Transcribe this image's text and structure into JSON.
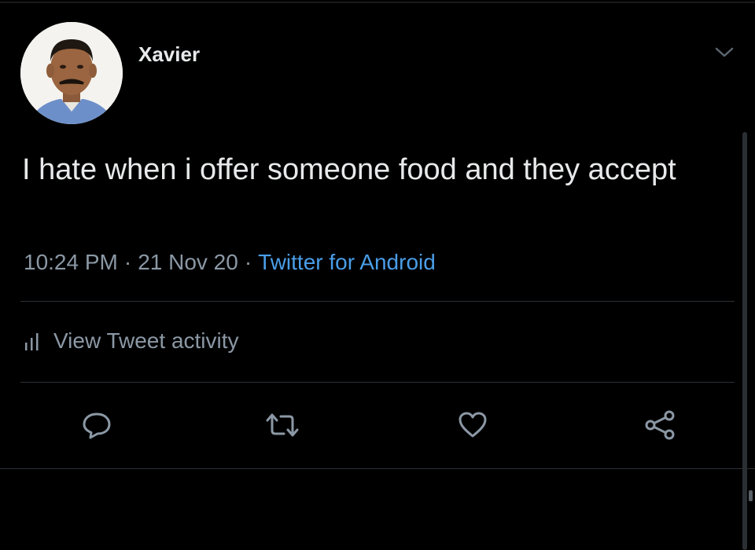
{
  "tweet": {
    "author_name": "Xavier",
    "text": "I hate when i offer someone food and they accept",
    "time": "10:24 PM",
    "date": "21 Nov 20",
    "separator": "·",
    "source": "Twitter for Android",
    "source_color": "#4a9ee8"
  },
  "activity": {
    "label": "View Tweet activity",
    "icon": "bar-chart-icon"
  },
  "actions": [
    {
      "name": "reply",
      "icon": "reply-icon"
    },
    {
      "name": "retweet",
      "icon": "retweet-icon"
    },
    {
      "name": "like",
      "icon": "heart-icon"
    },
    {
      "name": "share",
      "icon": "share-icon"
    }
  ],
  "colors": {
    "background": "#000000",
    "text": "#e7e9ea",
    "secondary": "#8b98a5",
    "divider": "#2c3136"
  }
}
